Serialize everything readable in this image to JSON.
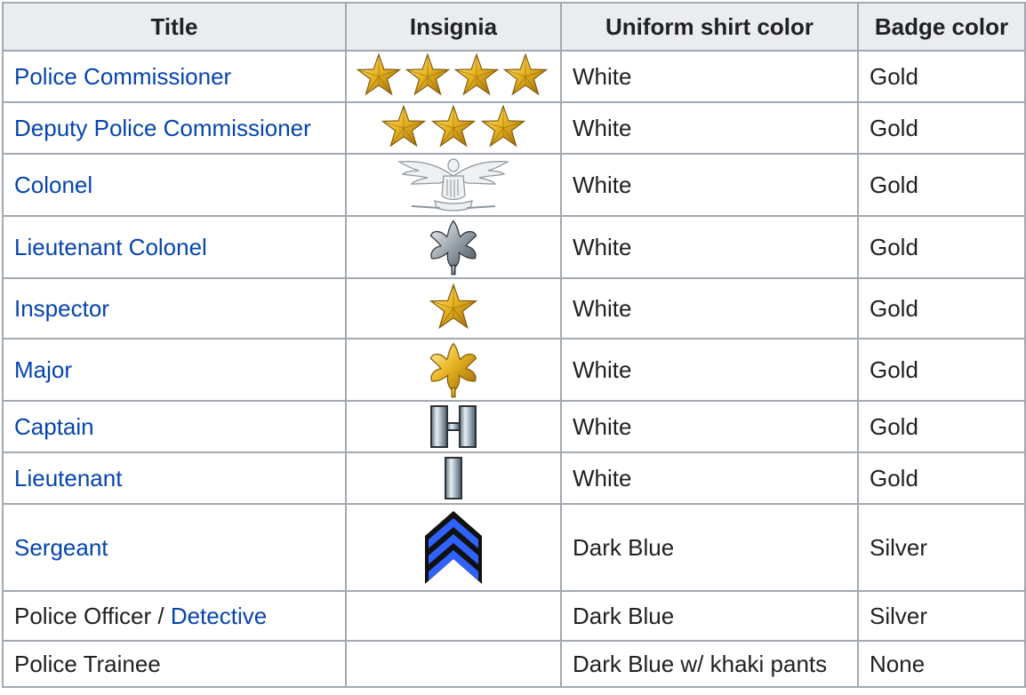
{
  "table": {
    "headers": {
      "title": "Title",
      "insignia": "Insignia",
      "shirt": "Uniform shirt color",
      "badge": "Badge color"
    },
    "rows": [
      {
        "title": "Police Commissioner",
        "insignia_icon": "four-gold-stars-icon",
        "shirt": "White",
        "badge": "Gold"
      },
      {
        "title": "Deputy Police Commissioner",
        "insignia_icon": "three-gold-stars-icon",
        "shirt": "White",
        "badge": "Gold"
      },
      {
        "title": "Colonel",
        "insignia_icon": "silver-eagle-icon",
        "shirt": "White",
        "badge": "Gold"
      },
      {
        "title": "Lieutenant Colonel",
        "insignia_icon": "silver-oak-leaf-icon",
        "shirt": "White",
        "badge": "Gold"
      },
      {
        "title": "Inspector",
        "insignia_icon": "gold-star-icon",
        "shirt": "White",
        "badge": "Gold"
      },
      {
        "title": "Major",
        "insignia_icon": "gold-oak-leaf-icon",
        "shirt": "White",
        "badge": "Gold"
      },
      {
        "title": "Captain",
        "insignia_icon": "double-silver-bar-icon",
        "shirt": "White",
        "badge": "Gold"
      },
      {
        "title": "Lieutenant",
        "insignia_icon": "single-silver-bar-icon",
        "shirt": "White",
        "badge": "Gold"
      },
      {
        "title": "Sergeant",
        "insignia_icon": "three-chevron-icon",
        "shirt": "Dark Blue",
        "badge": "Silver"
      },
      {
        "title_plain": "Police Officer / ",
        "title_link": "Detective",
        "shirt": "Dark Blue",
        "badge": "Silver"
      },
      {
        "title_plain": "Police Trainee",
        "shirt": "Dark Blue w/ khaki pants",
        "badge": "None"
      }
    ]
  },
  "colors": {
    "link": "#0645ad",
    "header_bg": "#eaecf0",
    "border": "#a2a9b1",
    "gold": "#e6b422",
    "silver": "#b8bec4",
    "chevron_blue": "#1f4fd8"
  }
}
